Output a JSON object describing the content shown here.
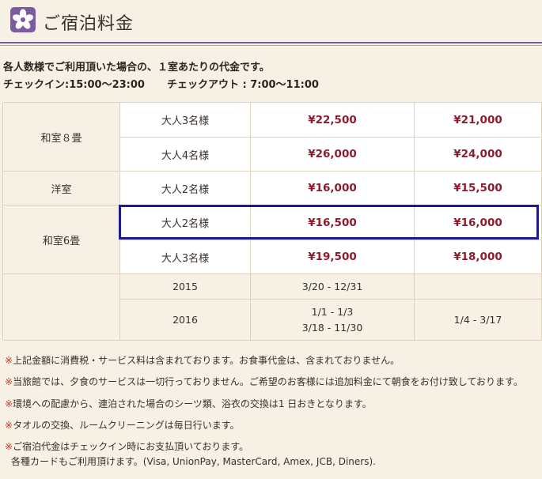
{
  "header": {
    "title": "ご宿泊料金",
    "logo_icon": "purple-flower-icon",
    "accent_color": "#7b5aa0"
  },
  "intro": {
    "line1": "各人数様でご利用頂いた場合の、１室あたりの代金です。",
    "checkin": "チェックイン:15:00〜23:00",
    "checkout": "チェックアウト : 7:00〜11:00"
  },
  "rates": {
    "rows": [
      {
        "room": "和室８畳",
        "occupancy": "大人3名様",
        "price_a": "¥22,500",
        "price_b": "¥21,000"
      },
      {
        "room": "",
        "occupancy": "大人4名様",
        "price_a": "¥26,000",
        "price_b": "¥24,000"
      },
      {
        "room": "洋室",
        "occupancy": "大人2名様",
        "price_a": "¥16,000",
        "price_b": "¥15,500"
      },
      {
        "room": "和室6畳",
        "occupancy": "大人2名様",
        "price_a": "¥16,500",
        "price_b": "¥16,000"
      },
      {
        "room": "",
        "occupancy": "大人3名様",
        "price_a": "¥19,500",
        "price_b": "¥18,000"
      }
    ],
    "seasons": [
      {
        "year": "2015",
        "period_a": [
          "3/20 - 12/31"
        ],
        "period_b": ""
      },
      {
        "year": "2016",
        "period_a": [
          "1/1 - 1/3",
          "3/18 - 11/30"
        ],
        "period_b": "1/4 - 3/17"
      }
    ],
    "price_color": "#8b1c2e",
    "highlight_color": "#1c1a8c"
  },
  "notes": {
    "mark": "※",
    "n1": "上記金額に消費税・サービス料は含まれております。お食事代金は、含まれておりません。",
    "n2": "当旅館では、夕食のサービスは一切行っておりません。ご希望のお客様には追加料金にて朝食をお付け致しております。",
    "n3": "環境への配慮から、連泊された場合のシーツ類、浴衣の交換は1 日おきとなります。",
    "n4": "タオルの交換、ルームクリーニングは毎日行います。",
    "n5": "ご宿泊代金はチェックイン時にお支払頂いております。",
    "n5_sub": "各種カードもご利用頂けます。(Visa, UnionPay, MasterCard, Amex, JCB, Diners)."
  }
}
